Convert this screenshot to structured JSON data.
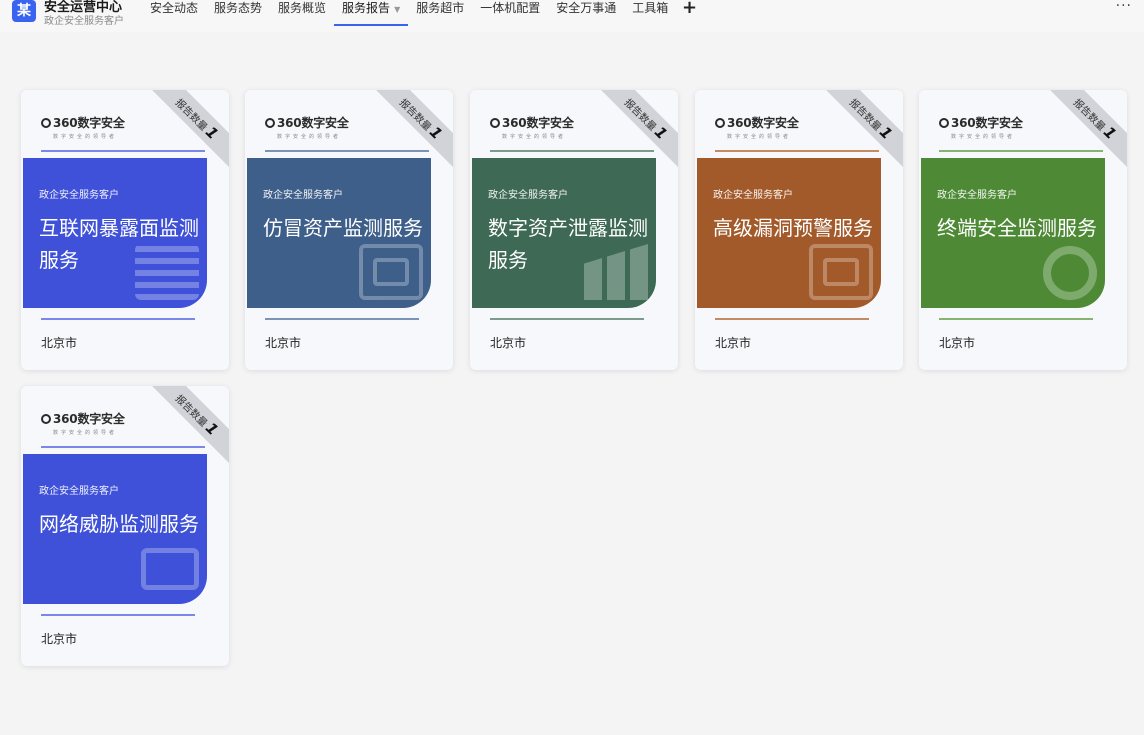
{
  "header": {
    "logo_char": "某",
    "title": "安全运营中心",
    "subtitle": "政企安全服务客户",
    "nav": [
      {
        "label": "安全动态",
        "active": false
      },
      {
        "label": "服务态势",
        "active": false
      },
      {
        "label": "服务概览",
        "active": false
      },
      {
        "label": "服务报告",
        "active": true,
        "caret": "▼"
      },
      {
        "label": "服务超市",
        "active": false
      },
      {
        "label": "一体机配置",
        "active": false
      },
      {
        "label": "安全万事通",
        "active": false
      },
      {
        "label": "工具箱",
        "active": false
      }
    ],
    "plus": "+",
    "more": "···"
  },
  "cards": [
    {
      "brand": "360数字安全",
      "brand_tagline": "数字安全的领导者",
      "ribbon_label": "报告数量",
      "ribbon_count": "1",
      "customer": "政企安全服务客户",
      "title": "互联网暴露面监测服务",
      "city": "北京市",
      "theme": "blue",
      "deco_icon": "server-stack-icon",
      "color": "#3e51d8"
    },
    {
      "brand": "360数字安全",
      "brand_tagline": "数字安全的领导者",
      "ribbon_label": "报告数量",
      "ribbon_count": "1",
      "customer": "政企安全服务客户",
      "title": "仿冒资产监测服务",
      "city": "北京市",
      "theme": "steel",
      "deco_icon": "shield-icon",
      "color": "#3e5f8a"
    },
    {
      "brand": "360数字安全",
      "brand_tagline": "数字安全的领导者",
      "ribbon_label": "报告数量",
      "ribbon_count": "1",
      "customer": "政企安全服务客户",
      "title": "数字资产泄露监测服务",
      "city": "北京市",
      "theme": "green",
      "deco_icon": "data-blocks-icon",
      "color": "#3e6a55"
    },
    {
      "brand": "360数字安全",
      "brand_tagline": "数字安全的领导者",
      "ribbon_label": "报告数量",
      "ribbon_count": "1",
      "customer": "政企安全服务客户",
      "title": "高级漏洞预警服务",
      "city": "北京市",
      "theme": "orange",
      "deco_icon": "vulnerability-icon",
      "color": "#a35a2b"
    },
    {
      "brand": "360数字安全",
      "brand_tagline": "数字安全的领导者",
      "ribbon_label": "报告数量",
      "ribbon_count": "1",
      "customer": "政企安全服务客户",
      "title": "终端安全监测服务",
      "city": "北京市",
      "theme": "olive",
      "deco_icon": "terminal-ring-icon",
      "color": "#4e8a36"
    },
    {
      "brand": "360数字安全",
      "brand_tagline": "数字安全的领导者",
      "ribbon_label": "报告数量",
      "ribbon_count": "1",
      "customer": "政企安全服务客户",
      "title": "网络威胁监测服务",
      "city": "北京市",
      "theme": "blue",
      "deco_icon": "monitor-icon",
      "color": "#3e51d8"
    }
  ]
}
